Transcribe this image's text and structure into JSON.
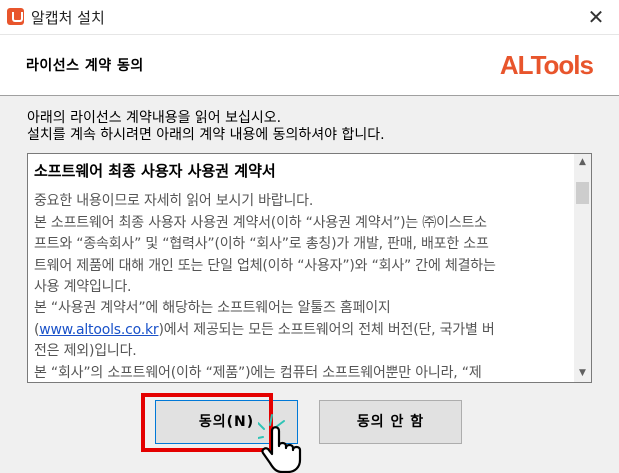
{
  "window": {
    "title": "알캡처 설치",
    "app_icon": "alcapture-app-icon",
    "close_glyph": "✕"
  },
  "header": {
    "title": "라이선스 계약 동의",
    "logo": "ALTools",
    "logo_color": "#e8552c"
  },
  "instructions": [
    "아래의 라이선스 계약내용을 읽어 보십시오.",
    "설치를 계속 하시려면 아래의 계약 내용에 동의하셔야 합니다."
  ],
  "license": {
    "heading": "소프트웨어 최종 사용자 사용권 계약서",
    "lines": [
      "중요한 내용이므로 자세히 읽어 보시기 바랍니다.",
      "본 소프트웨어 최종 사용자 사용권 계약서(이하 “사용권 계약서”)는 ㈜이스트소",
      "프트와 “종속회사” 및 “협력사”(이하 “회사”로 총칭)가 개발, 판매, 배포한 소프",
      "트웨어 제품에 대해 개인 또는 단일 업체(이하 “사용자”)와 “회사” 간에 체결하는",
      "사용 계약입니다.",
      "본 “사용권 계약서”에 해당하는 소프트웨어는 알툴즈 홈페이지"
    ],
    "link_line": {
      "prefix": "(",
      "link": "www.altools.co.kr",
      "suffix": ")에서 제공되는 모든 소프트웨어의 전체 버전(단, 국가별 버"
    },
    "lines_after": [
      "전은 제외)입니다.",
      "본 “회사”의 소프트웨어(이하 “제품”)에는 컴퓨터 소프트웨어뿐만 아니라, “제"
    ]
  },
  "buttons": {
    "agree": "동의(N)",
    "disagree": "동의 안 함"
  },
  "colors": {
    "highlight": "#e40000",
    "link": "#1a52c9"
  }
}
